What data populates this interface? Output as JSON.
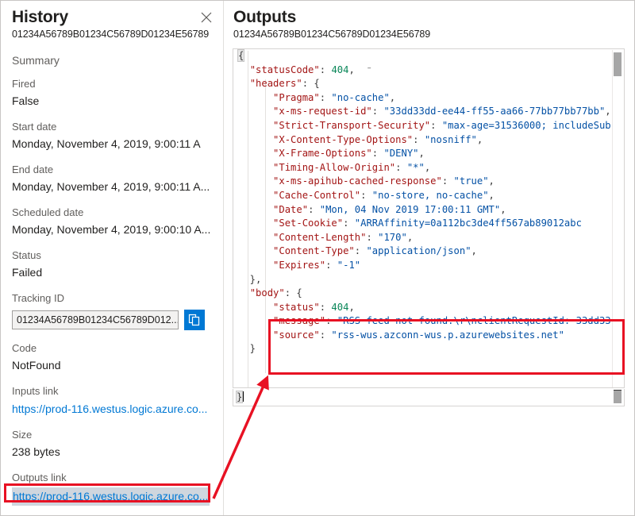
{
  "history": {
    "title": "History",
    "run_id": "01234A56789B01234C56789D01234E56789",
    "close_icon": "close-icon",
    "summary_heading": "Summary",
    "fields": {
      "fired_label": "Fired",
      "fired_value": "False",
      "start_date_label": "Start date",
      "start_date_value": "Monday, November 4, 2019, 9:00:11 A",
      "end_date_label": "End date",
      "end_date_value": "Monday, November 4, 2019, 9:00:11 A...",
      "scheduled_date_label": "Scheduled date",
      "scheduled_date_value": "Monday, November 4, 2019, 9:00:10 A...",
      "status_label": "Status",
      "status_value": "Failed",
      "tracking_id_label": "Tracking ID",
      "tracking_id_value": "01234A56789B01234C56789D012...",
      "copy_icon": "copy-icon",
      "code_label": "Code",
      "code_value": "NotFound",
      "inputs_link_label": "Inputs link",
      "inputs_link_value": "https://prod-116.westus.logic.azure.co...",
      "size_label": "Size",
      "size_value": "238 bytes",
      "outputs_link_label": "Outputs link",
      "outputs_link_value": "https://prod-116.westus.logic.azure.co..."
    }
  },
  "outputs": {
    "title": "Outputs",
    "run_id": "01234A56789B01234C56789D01234E56789",
    "bottom_bar_text": "}"
  },
  "colors": {
    "accent": "#0078d4",
    "annotation": "#e81123",
    "json_key": "#a31515",
    "json_string": "#0451a5",
    "json_number": "#098658",
    "link": "#0078d4",
    "selection": "#cfd6de"
  },
  "code": {
    "language": "json",
    "lines": [
      [
        {
          "t": "punc",
          "v": "{"
        }
      ],
      [
        {
          "t": "punc",
          "v": "  "
        },
        {
          "t": "key",
          "v": "\"statusCode\""
        },
        {
          "t": "punc",
          "v": ": "
        },
        {
          "t": "num",
          "v": "404"
        },
        {
          "t": "punc",
          "v": ",  ⁻"
        }
      ],
      [
        {
          "t": "punc",
          "v": "  "
        },
        {
          "t": "key",
          "v": "\"headers\""
        },
        {
          "t": "punc",
          "v": ": {"
        }
      ],
      [
        {
          "t": "punc",
          "v": "      "
        },
        {
          "t": "key",
          "v": "\"Pragma\""
        },
        {
          "t": "punc",
          "v": ": "
        },
        {
          "t": "str",
          "v": "\"no-cache\""
        },
        {
          "t": "punc",
          "v": ","
        }
      ],
      [
        {
          "t": "punc",
          "v": "      "
        },
        {
          "t": "key",
          "v": "\"x-ms-request-id\""
        },
        {
          "t": "punc",
          "v": ": "
        },
        {
          "t": "str",
          "v": "\"33dd33dd-ee44-ff55-aa66-77bb77bb77bb\""
        },
        {
          "t": "punc",
          "v": ","
        }
      ],
      [
        {
          "t": "punc",
          "v": "      "
        },
        {
          "t": "key",
          "v": "\"Strict-Transport-Security\""
        },
        {
          "t": "punc",
          "v": ": "
        },
        {
          "t": "str",
          "v": "\"max-age=31536000; includeSub"
        }
      ],
      [
        {
          "t": "punc",
          "v": "      "
        },
        {
          "t": "key",
          "v": "\"X-Content-Type-Options\""
        },
        {
          "t": "punc",
          "v": ": "
        },
        {
          "t": "str",
          "v": "\"nosniff\""
        },
        {
          "t": "punc",
          "v": ","
        }
      ],
      [
        {
          "t": "punc",
          "v": "      "
        },
        {
          "t": "key",
          "v": "\"X-Frame-Options\""
        },
        {
          "t": "punc",
          "v": ": "
        },
        {
          "t": "str",
          "v": "\"DENY\""
        },
        {
          "t": "punc",
          "v": ","
        }
      ],
      [
        {
          "t": "punc",
          "v": "      "
        },
        {
          "t": "key",
          "v": "\"Timing-Allow-Origin\""
        },
        {
          "t": "punc",
          "v": ": "
        },
        {
          "t": "str",
          "v": "\"*\""
        },
        {
          "t": "punc",
          "v": ","
        }
      ],
      [
        {
          "t": "punc",
          "v": "      "
        },
        {
          "t": "key",
          "v": "\"x-ms-apihub-cached-response\""
        },
        {
          "t": "punc",
          "v": ": "
        },
        {
          "t": "str",
          "v": "\"true\""
        },
        {
          "t": "punc",
          "v": ","
        }
      ],
      [
        {
          "t": "punc",
          "v": "      "
        },
        {
          "t": "key",
          "v": "\"Cache-Control\""
        },
        {
          "t": "punc",
          "v": ": "
        },
        {
          "t": "str",
          "v": "\"no-store, no-cache\""
        },
        {
          "t": "punc",
          "v": ","
        }
      ],
      [
        {
          "t": "punc",
          "v": "      "
        },
        {
          "t": "key",
          "v": "\"Date\""
        },
        {
          "t": "punc",
          "v": ": "
        },
        {
          "t": "str",
          "v": "\"Mon, 04 Nov 2019 17:00:11 GMT\""
        },
        {
          "t": "punc",
          "v": ","
        }
      ],
      [
        {
          "t": "punc",
          "v": "      "
        },
        {
          "t": "key",
          "v": "\"Set-Cookie\""
        },
        {
          "t": "punc",
          "v": ": "
        },
        {
          "t": "str",
          "v": "\"ARRAffinity=0a112bc3de4ff567ab89012abc"
        }
      ],
      [
        {
          "t": "punc",
          "v": "      "
        },
        {
          "t": "key",
          "v": "\"Content-Length\""
        },
        {
          "t": "punc",
          "v": ": "
        },
        {
          "t": "str",
          "v": "\"170\""
        },
        {
          "t": "punc",
          "v": ","
        }
      ],
      [
        {
          "t": "punc",
          "v": "      "
        },
        {
          "t": "key",
          "v": "\"Content-Type\""
        },
        {
          "t": "punc",
          "v": ": "
        },
        {
          "t": "str",
          "v": "\"application/json\""
        },
        {
          "t": "punc",
          "v": ","
        }
      ],
      [
        {
          "t": "punc",
          "v": "      "
        },
        {
          "t": "key",
          "v": "\"Expires\""
        },
        {
          "t": "punc",
          "v": ": "
        },
        {
          "t": "str",
          "v": "\"-1\""
        }
      ],
      [
        {
          "t": "punc",
          "v": "  },"
        }
      ],
      [
        {
          "t": "punc",
          "v": "  "
        },
        {
          "t": "key",
          "v": "\"body\""
        },
        {
          "t": "punc",
          "v": ": {"
        }
      ],
      [
        {
          "t": "punc",
          "v": "      "
        },
        {
          "t": "key",
          "v": "\"status\""
        },
        {
          "t": "punc",
          "v": ": "
        },
        {
          "t": "num",
          "v": "404"
        },
        {
          "t": "punc",
          "v": ","
        }
      ],
      [
        {
          "t": "punc",
          "v": "      "
        },
        {
          "t": "key",
          "v": "\"message\""
        },
        {
          "t": "punc",
          "v": ": "
        },
        {
          "t": "str",
          "v": "\"RSS feed not found.\\r\\nclientRequestId: 33dd33"
        }
      ],
      [
        {
          "t": "punc",
          "v": "      "
        },
        {
          "t": "key",
          "v": "\"source\""
        },
        {
          "t": "punc",
          "v": ": "
        },
        {
          "t": "str",
          "v": "\"rss-wus.azconn-wus.p.azurewebsites.net\""
        }
      ],
      [
        {
          "t": "punc",
          "v": "  }"
        }
      ]
    ]
  },
  "annotations": {
    "json_box_label": "body-fields-highlight",
    "link_box_label": "outputs-link-highlight",
    "arrow_label": "callout-arrow"
  }
}
